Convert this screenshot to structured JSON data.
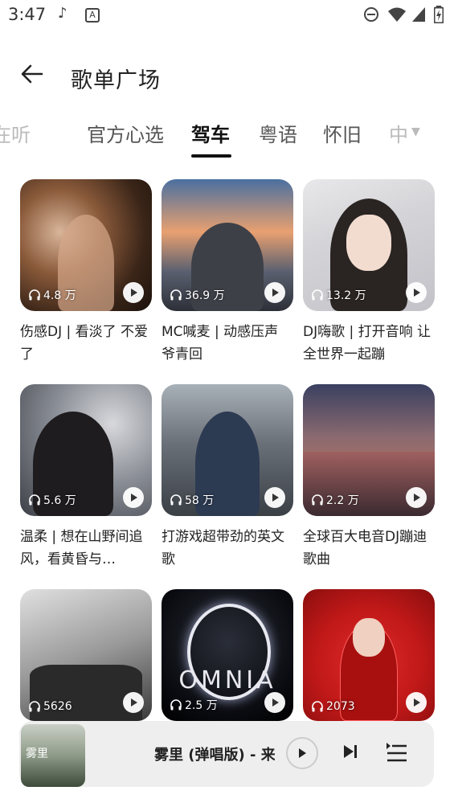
{
  "status_bar": {
    "time": "3:47"
  },
  "header": {
    "title": "歌单广场"
  },
  "tabs": [
    {
      "label": "在听"
    },
    {
      "label": "官方心选"
    },
    {
      "label": "驾车"
    },
    {
      "label": "粤语"
    },
    {
      "label": "怀旧"
    },
    {
      "label": "中"
    }
  ],
  "playlists": [
    {
      "title": "伤感DJ | 看淡了 不爱了",
      "play_count": "4.8 万"
    },
    {
      "title": "MC喊麦 | 动感压声 爷青回",
      "play_count": "36.9 万"
    },
    {
      "title": "DJ嗨歌 | 打开音响 让全世界一起蹦",
      "play_count": "13.2 万"
    },
    {
      "title": "温柔 | 想在山野间追风，看黄昏与…",
      "play_count": "5.6 万"
    },
    {
      "title": "打游戏超带劲的英文歌",
      "play_count": "58 万"
    },
    {
      "title": "全球百大电音DJ蹦迪歌曲",
      "play_count": "2.2 万"
    },
    {
      "title": "",
      "play_count": "5626"
    },
    {
      "title": "",
      "play_count": "2.5 万"
    },
    {
      "title": "",
      "play_count": "2073"
    }
  ],
  "cover_text": {
    "omnia": "OMNIA",
    "player_cover": "雾里"
  },
  "player": {
    "title": "雾里 (弹唱版) - 来"
  }
}
